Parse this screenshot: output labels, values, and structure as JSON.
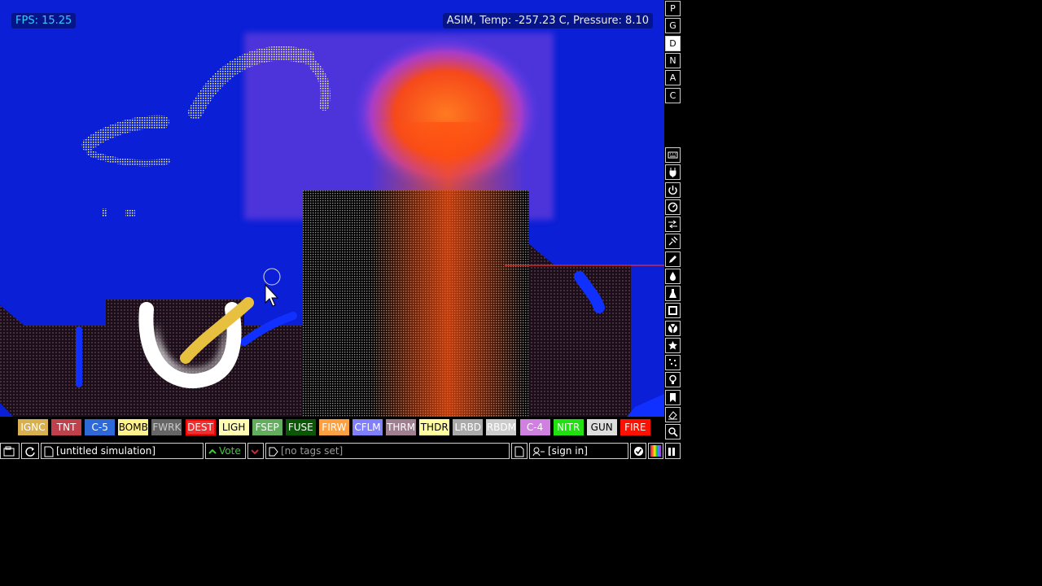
{
  "hud": {
    "fps": "FPS: 15.25",
    "position_info": "ASIM, Temp: -257.23 C, Pressure: 8.10"
  },
  "modes": [
    "P",
    "G",
    "D",
    "N",
    "A",
    "C"
  ],
  "active_mode": "D",
  "tool_icons": [
    "keyboard-icon",
    "plug-icon",
    "power-icon",
    "gauge-icon",
    "arrows-icon",
    "force-icon",
    "pencil-icon",
    "drop-icon",
    "flask-icon",
    "square-icon",
    "radiation-icon",
    "star-icon",
    "dots-icon",
    "lightbulb-icon",
    "bookmark-icon",
    "eraser-icon",
    "magnifier-icon"
  ],
  "elements": [
    {
      "label": "IGNC",
      "bg": "#d8b050",
      "fg": "#ffffff"
    },
    {
      "label": "TNT",
      "bg": "#c0404c",
      "fg": "#ffffff"
    },
    {
      "label": "C-5",
      "bg": "#2d6ad8",
      "fg": "#ffffff"
    },
    {
      "label": "BOMB",
      "bg": "#fff28a",
      "fg": "#000000"
    },
    {
      "label": "FWRK",
      "bg": "#666666",
      "fg": "#cccccc"
    },
    {
      "label": "DEST",
      "bg": "#f03030",
      "fg": "#ffffff"
    },
    {
      "label": "LIGH",
      "bg": "#fffbb0",
      "fg": "#000000"
    },
    {
      "label": "FSEP",
      "bg": "#63ad5f",
      "fg": "#ffffff"
    },
    {
      "label": "FUSE",
      "bg": "#0a5706",
      "fg": "#ffffff"
    },
    {
      "label": "FIRW",
      "bg": "#ffa040",
      "fg": "#ffffff"
    },
    {
      "label": "CFLM",
      "bg": "#8080ff",
      "fg": "#ffffff"
    },
    {
      "label": "THRM",
      "bg": "#a08090",
      "fg": "#ffffff"
    },
    {
      "label": "THDR",
      "bg": "#ffffa0",
      "fg": "#000000"
    },
    {
      "label": "LRBD",
      "bg": "#aaaaaa",
      "fg": "#ffffff"
    },
    {
      "label": "RBDM",
      "bg": "#cccccc",
      "fg": "#ffffff"
    },
    {
      "label": "C-4",
      "bg": "#d080e0",
      "fg": "#ffffff"
    },
    {
      "label": "NITR",
      "bg": "#20e010",
      "fg": "#ffffff"
    },
    {
      "label": "GUN",
      "bg": "#dddddd",
      "fg": "#000000"
    },
    {
      "label": "FIRE",
      "bg": "#ff1000",
      "fg": "#ffffff"
    }
  ],
  "selected_element": "DEST",
  "bottom_bar": {
    "save_title": "[untitled simulation]",
    "vote_label": "Vote",
    "tags": "[no tags set]",
    "sign_in": "[sign in]"
  },
  "colors": {
    "sim_blue": "#0a1fd6",
    "fire_orange": "#ff5a10",
    "wall_purple": "#3a2330",
    "vote_green": "#3ecb3e",
    "vote_down_red": "#c03030"
  }
}
